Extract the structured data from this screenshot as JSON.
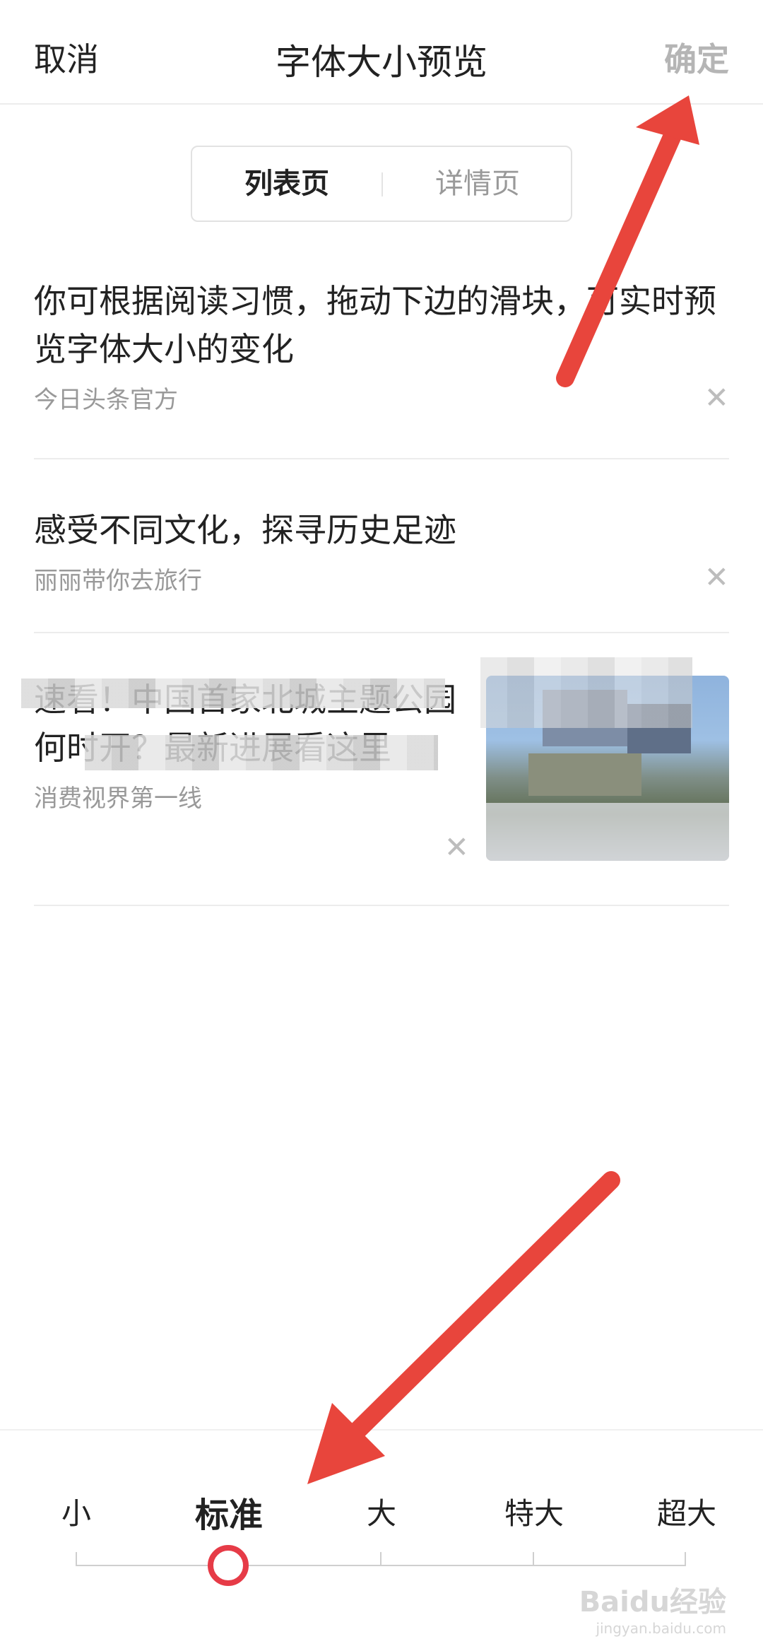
{
  "header": {
    "cancel_label": "取消",
    "title": "字体大小预览",
    "confirm_label": "确定"
  },
  "segment": {
    "options": [
      "列表页",
      "详情页"
    ],
    "selected": "列表页"
  },
  "feed": [
    {
      "headline": "你可根据阅读习惯，拖动下边的滑块，可实时预览字体大小的变化",
      "source": "今日头条官方"
    },
    {
      "headline": "感受不同文化，探寻历史足迹",
      "source": "丽丽带你去旅行"
    },
    {
      "headline": "速看！中国首家北城主题公园何时开？最新进展看这里",
      "source": "消费视界第一线"
    }
  ],
  "font_size": {
    "levels": [
      "小",
      "标准",
      "大",
      "特大",
      "超大"
    ],
    "selected": "标准",
    "selected_index": 1
  },
  "watermark": {
    "brand": "Baidu经验",
    "url": "jingyan.baidu.com"
  },
  "colors": {
    "accent": "#e63b47",
    "arrow": "#e8453c",
    "confirm_disabled": "#b5b5b5"
  },
  "icons": [
    "close-icon",
    "slider-knob"
  ]
}
